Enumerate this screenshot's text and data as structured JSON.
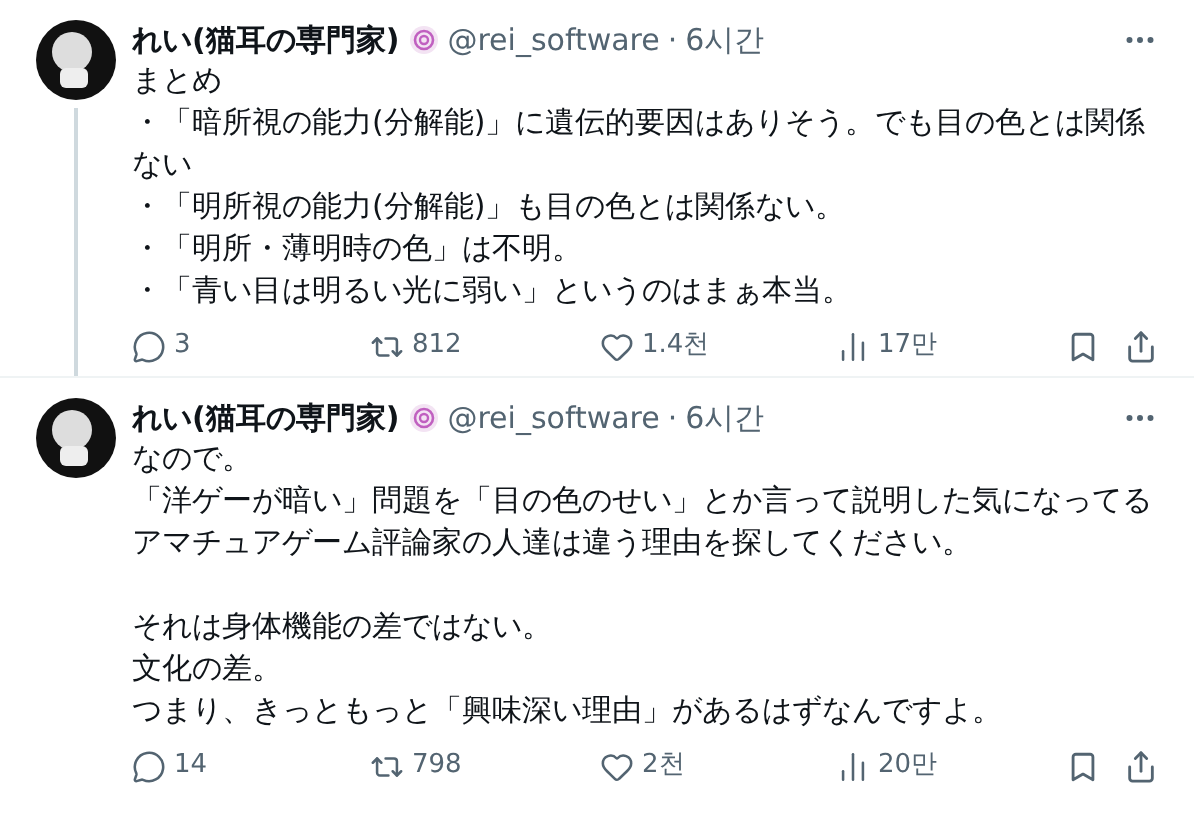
{
  "tweets": [
    {
      "name": "れい(猫耳の専門家)",
      "handle": "@rei_software",
      "separator": "·",
      "time": "6시간",
      "thread_line": true,
      "paragraphs": [
        [
          "まとめ",
          "・「暗所視の能力(分解能)」に遺伝的要因はありそう。でも目の色とは関係ない",
          "・「明所視の能力(分解能)」も目の色とは関係ない。",
          "・「明所・薄明時の色」は不明。",
          "・「青い目は明るい光に弱い」というのはまぁ本当。"
        ]
      ],
      "replies": "3",
      "reposts": "812",
      "likes": "1.4천",
      "views": "17만"
    },
    {
      "name": "れい(猫耳の専門家)",
      "handle": "@rei_software",
      "separator": "·",
      "time": "6시간",
      "thread_line": false,
      "paragraphs": [
        [
          "なので。",
          "「洋ゲーが暗い」問題を「目の色のせい」とか言って説明した気になってる",
          "アマチュアゲーム評論家の人達は違う理由を探してください。"
        ],
        [
          "それは身体機能の差ではない。",
          "文化の差。",
          "つまり、きっともっと「興味深い理由」があるはずなんですよ。"
        ]
      ],
      "replies": "14",
      "reposts": "798",
      "likes": "2천",
      "views": "20만"
    }
  ]
}
